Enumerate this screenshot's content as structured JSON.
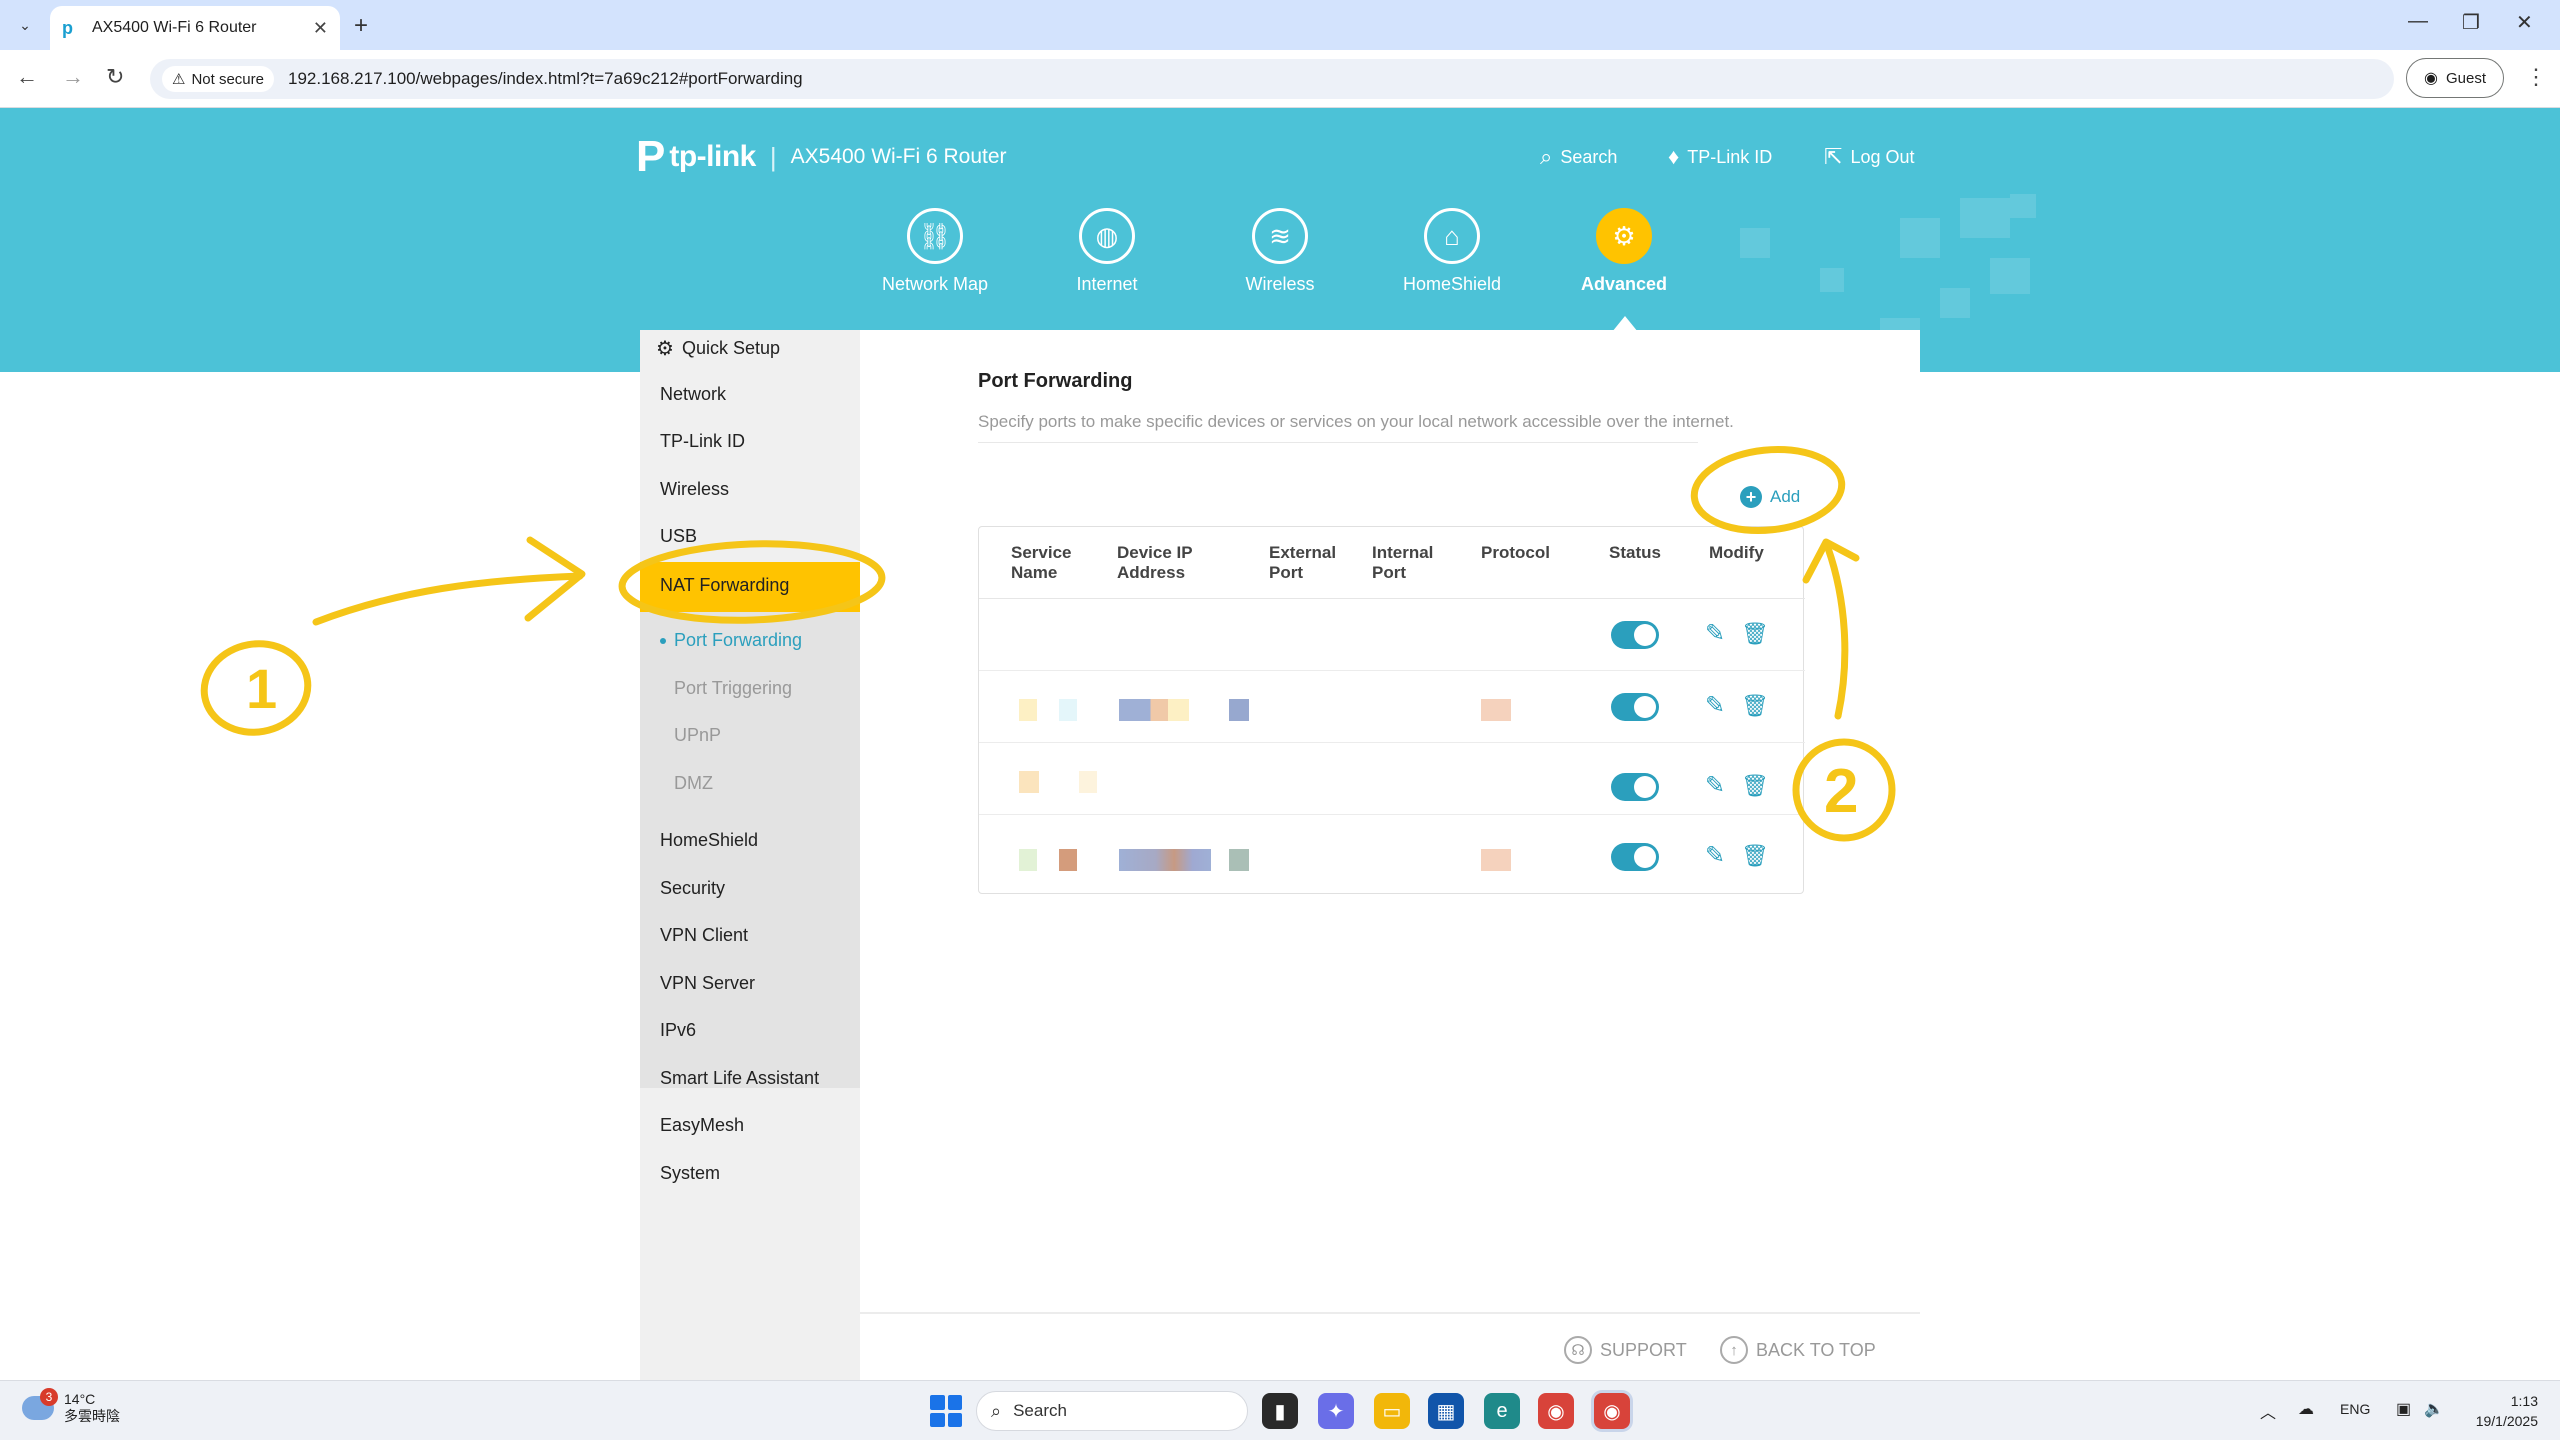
{
  "browser": {
    "tab_title": "AX5400 Wi-Fi 6 Router",
    "security_label": "Not secure",
    "url": "192.168.217.100/webpages/index.html?t=7a69c212#portForwarding",
    "profile_label": "Guest"
  },
  "header": {
    "brand": "tp-link",
    "model": "AX5400 Wi-Fi 6 Router",
    "links": [
      {
        "label": "Search",
        "icon": "search-icon"
      },
      {
        "label": "TP-Link ID",
        "icon": "user-pin-icon"
      },
      {
        "label": "Log Out",
        "icon": "logout-icon"
      }
    ]
  },
  "main_nav": [
    {
      "label": "Network Map",
      "icon": "network-map-icon"
    },
    {
      "label": "Internet",
      "icon": "globe-icon"
    },
    {
      "label": "Wireless",
      "icon": "wifi-icon"
    },
    {
      "label": "HomeShield",
      "icon": "home-shield-icon"
    },
    {
      "label": "Advanced",
      "icon": "gear-icon",
      "active": true
    }
  ],
  "sidebar": {
    "items": [
      {
        "label": "Quick Setup"
      },
      {
        "label": "Network"
      },
      {
        "label": "TP-Link ID"
      },
      {
        "label": "Wireless"
      },
      {
        "label": "USB"
      },
      {
        "label": "NAT Forwarding",
        "active": true
      },
      {
        "label": "HomeShield"
      },
      {
        "label": "Security"
      },
      {
        "label": "VPN Client"
      },
      {
        "label": "VPN Server"
      },
      {
        "label": "IPv6"
      },
      {
        "label": "Smart Life Assistant"
      },
      {
        "label": "EasyMesh"
      },
      {
        "label": "System"
      }
    ],
    "sub_items": [
      {
        "label": "Port Forwarding",
        "current": true
      },
      {
        "label": "Port Triggering"
      },
      {
        "label": "UPnP"
      },
      {
        "label": "DMZ"
      }
    ]
  },
  "page": {
    "title": "Port Forwarding",
    "description": "Specify ports to make specific devices or services on your local network accessible over the internet.",
    "add_label": "Add"
  },
  "table": {
    "headers": {
      "service_name": [
        "Service",
        "Name"
      ],
      "device_ip": [
        "Device IP",
        "Address"
      ],
      "external_port": [
        "External",
        "Port"
      ],
      "internal_port": [
        "Internal",
        "Port"
      ],
      "protocol": "Protocol",
      "status": "Status",
      "modify": "Modify"
    },
    "rows": [
      {
        "status_on": true
      },
      {
        "status_on": true
      },
      {
        "status_on": true
      },
      {
        "status_on": true
      }
    ]
  },
  "footer": {
    "support_label": "SUPPORT",
    "back_to_top_label": "BACK TO TOP"
  },
  "annotations": {
    "step1": "1",
    "step2": "2",
    "color": "#f5c518"
  },
  "taskbar": {
    "weather_temp": "14°C",
    "weather_desc": "多雲時陰",
    "weather_badge": "3",
    "search_placeholder": "Search",
    "lang": "ENG",
    "time": "1:13",
    "date": "19/1/2025"
  },
  "colors": {
    "brand_teal": "#4cc2d7",
    "accent_yellow": "#ffc300",
    "link_blue": "#2b9fbd"
  }
}
